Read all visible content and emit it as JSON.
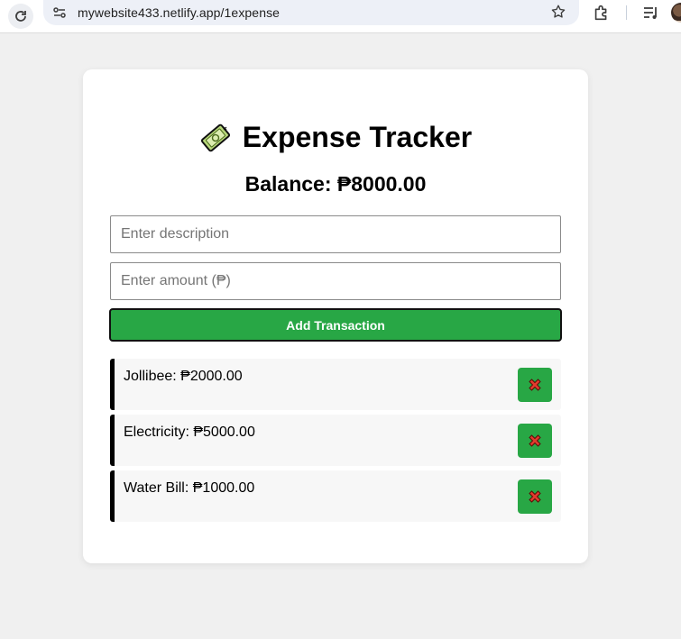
{
  "browser": {
    "url": "mywebsite433.netlify.app/1expense"
  },
  "app": {
    "title": "Expense Tracker",
    "balance": "Balance: ₱8000.00",
    "description_placeholder": "Enter description",
    "amount_placeholder": "Enter amount (₱)",
    "add_button_label": "Add Transaction",
    "transactions": [
      {
        "label": "Jollibee: ₱2000.00"
      },
      {
        "label": "Electricity: ₱5000.00"
      },
      {
        "label": "Water Bill: ₱1000.00"
      }
    ],
    "colors": {
      "accent": "#28a745",
      "background": "#f0f0f0",
      "card": "#ffffff"
    },
    "icons": {
      "title_icon": "money-icon",
      "delete_icon": "cross-mark-icon"
    }
  }
}
